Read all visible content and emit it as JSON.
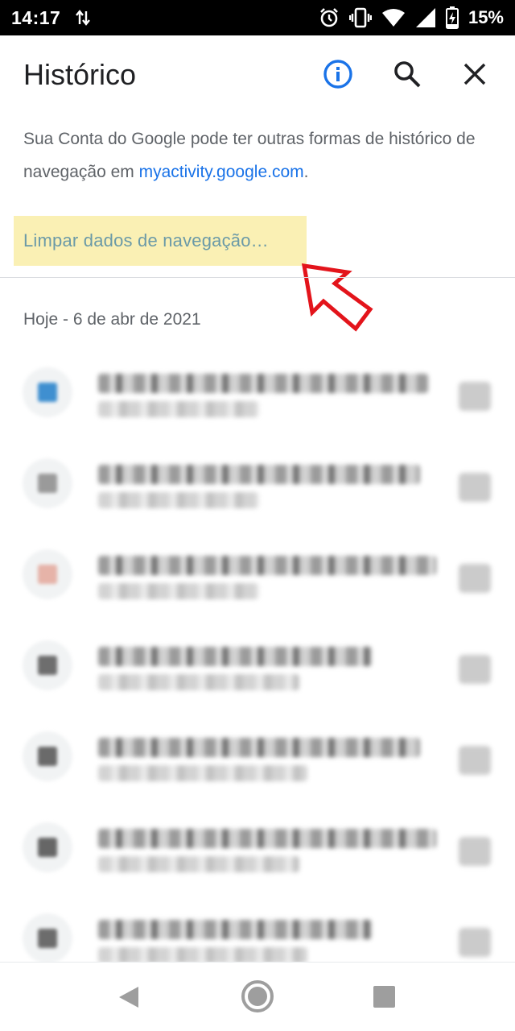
{
  "status_bar": {
    "time": "14:17",
    "battery_percent": "15%",
    "icons": [
      "data-sync-icon",
      "alarm-icon",
      "vibrate-icon",
      "wifi-icon",
      "signal-icon",
      "battery-charging-icon"
    ]
  },
  "header": {
    "title": "Histórico",
    "icons": [
      "info-icon",
      "search-icon",
      "close-icon"
    ],
    "info_color": "#1a73e8"
  },
  "description": {
    "text": "Sua Conta do Google pode ter outras formas de histórico de navegação em ",
    "link": "myactivity.google.com",
    "suffix": "."
  },
  "clear_data": {
    "label": "Limpar dados de navegação…",
    "highlight_color": "#faf0b4",
    "annotation_color": "#e3141b"
  },
  "history": {
    "date_header": "Hoje - 6 de abr de 2021",
    "items": [
      {
        "favicon_color": "#3f8fd0",
        "title_width": 410,
        "url_width": 200
      },
      {
        "favicon_color": "#9a9a9a",
        "title_width": 400,
        "url_width": 200
      },
      {
        "favicon_color": "#e6b3a8",
        "title_width": 420,
        "url_width": 200
      },
      {
        "favicon_color": "#6e6e6e",
        "title_width": 340,
        "url_width": 250
      },
      {
        "favicon_color": "#6a6a6a",
        "title_width": 400,
        "url_width": 260
      },
      {
        "favicon_color": "#666666",
        "title_width": 420,
        "url_width": 250
      },
      {
        "favicon_color": "#6c6c6c",
        "title_width": 340,
        "url_width": 260
      }
    ]
  },
  "navbar": {
    "icons": [
      "back-icon",
      "home-icon",
      "recents-icon"
    ]
  }
}
